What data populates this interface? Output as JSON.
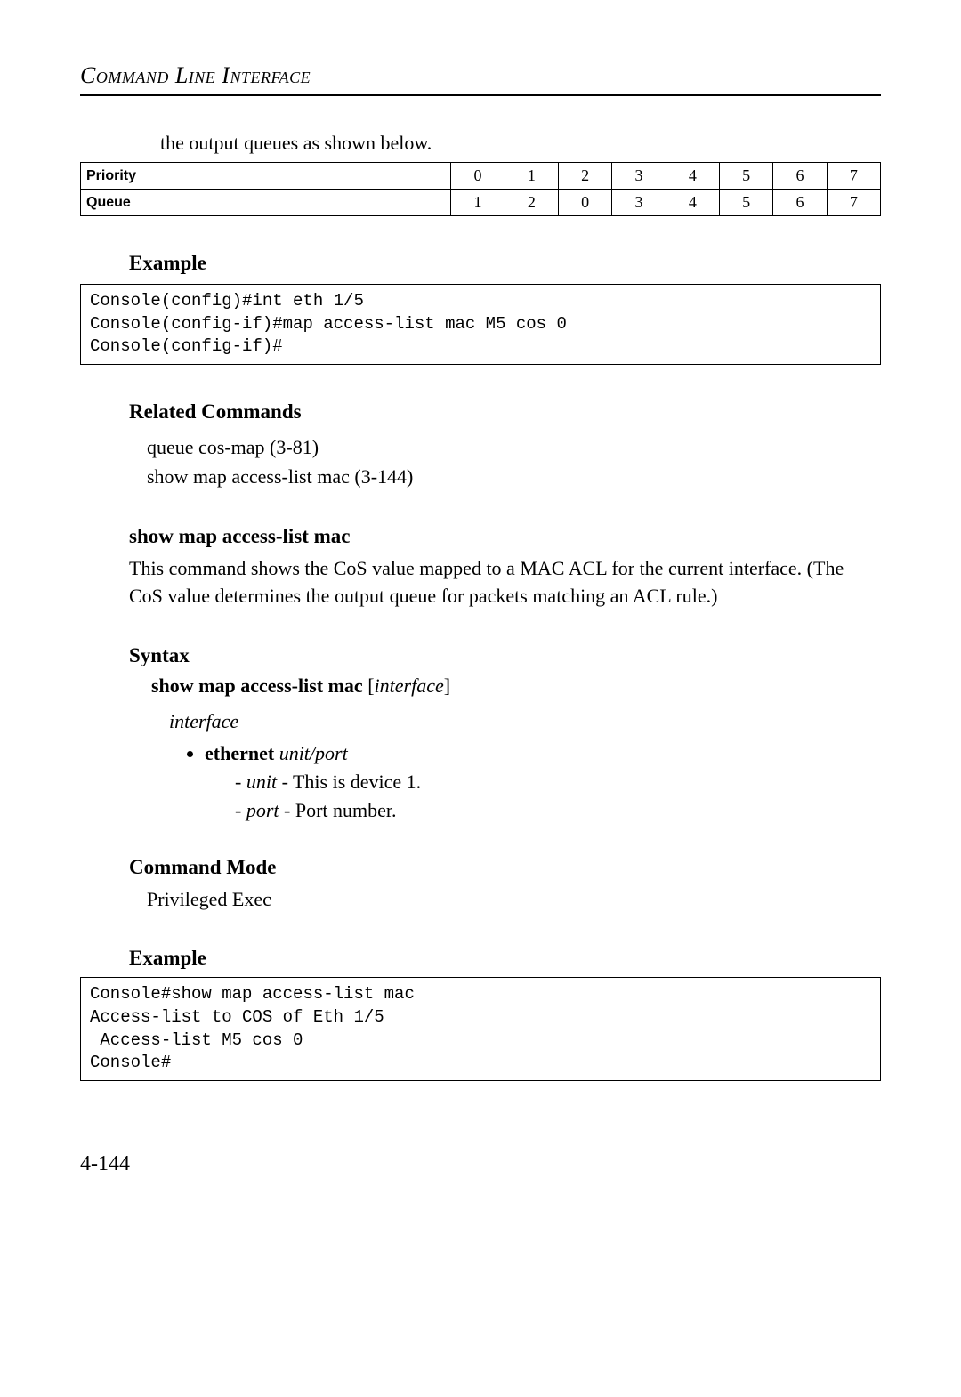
{
  "header": "Command Line Interface",
  "intro_line": "the output queues as shown below.",
  "table": {
    "row_labels": [
      "Priority",
      "Queue"
    ],
    "priority": [
      "0",
      "1",
      "2",
      "3",
      "4",
      "5",
      "6",
      "7"
    ],
    "queue": [
      "1",
      "2",
      "0",
      "3",
      "4",
      "5",
      "6",
      "7"
    ]
  },
  "example1": {
    "heading": "Example",
    "code": "Console(config)#int eth 1/5\nConsole(config-if)#map access-list mac M5 cos 0\nConsole(config-if)#"
  },
  "related": {
    "heading": "Related Commands",
    "items": [
      "queue cos-map (3-81)",
      "show map access-list mac (3-144)"
    ]
  },
  "cmd": {
    "title": "show map access-list mac",
    "desc": "This command shows the CoS value mapped to a MAC ACL for the current interface. (The CoS value determines the output queue for packets matching an ACL rule.)",
    "syntax_heading": "Syntax",
    "syntax_bold": "show map access-list mac",
    "syntax_ital": "interface",
    "param_label": "interface",
    "bullet_bold": "ethernet",
    "bullet_ital": "unit/port",
    "dash1_ital": "unit",
    "dash1_rest": " - This is device 1.",
    "dash2_ital": "port",
    "dash2_rest": " - Port number.",
    "mode_heading": "Command Mode",
    "mode_value": "Privileged Exec"
  },
  "example2": {
    "heading": "Example",
    "code": "Console#show map access-list mac\nAccess-list to COS of Eth 1/5\n Access-list M5 cos 0\nConsole#"
  },
  "page_number": "4-144"
}
